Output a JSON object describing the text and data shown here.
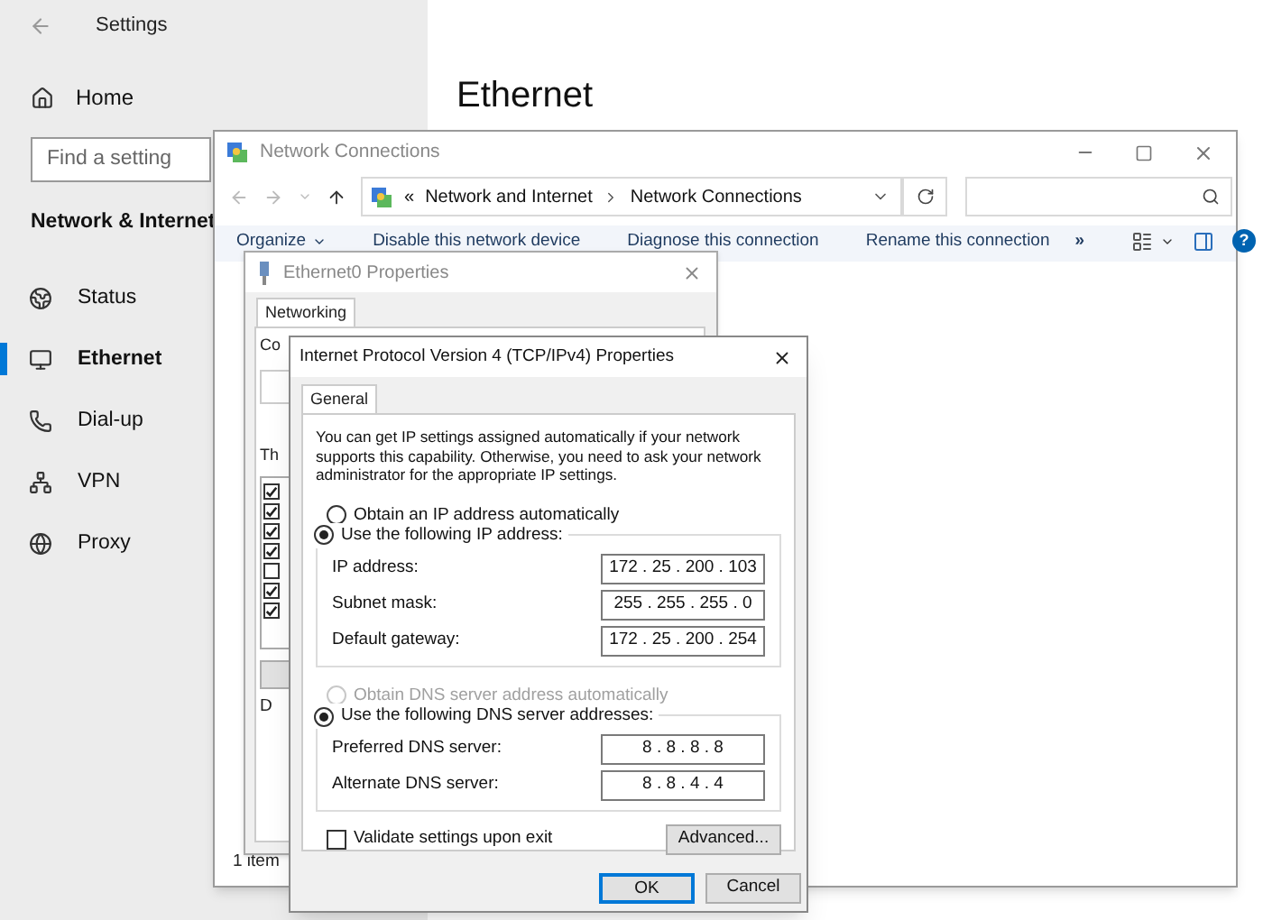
{
  "settings": {
    "title": "Settings",
    "home": "Home",
    "search": {
      "placeholder": "Find a setting"
    },
    "section": "Network & Internet",
    "nav": [
      {
        "label": "Status",
        "kind": "status",
        "selected": false
      },
      {
        "label": "Ethernet",
        "kind": "ethernet",
        "selected": true
      },
      {
        "label": "Dial-up",
        "kind": "dialup",
        "selected": false
      },
      {
        "label": "VPN",
        "kind": "vpn",
        "selected": false
      },
      {
        "label": "Proxy",
        "kind": "proxy",
        "selected": false
      }
    ],
    "page_title": "Ethernet"
  },
  "network_connections": {
    "title": "Network Connections",
    "breadcrumb_prefix": "«",
    "breadcrumb": [
      "Network and Internet",
      "Network Connections"
    ],
    "toolbar": [
      "Organize",
      "Disable this network device",
      "Diagnose this connection",
      "Rename this connection"
    ],
    "toolbar_more": "»",
    "help": "?",
    "status": "1 item"
  },
  "ethernet_properties": {
    "title": "Ethernet0 Properties",
    "tabs": [
      {
        "label": "Networking",
        "selected": true
      }
    ],
    "connect_label": "Co",
    "items_label": "Th",
    "description_label": "D",
    "components": [
      {
        "checked": true
      },
      {
        "checked": true
      },
      {
        "checked": true
      },
      {
        "checked": true
      },
      {
        "checked": false
      },
      {
        "checked": true
      },
      {
        "checked": true
      }
    ]
  },
  "ipv4": {
    "title": "Internet Protocol Version 4 (TCP/IPv4) Properties",
    "tabs": [
      {
        "label": "General",
        "selected": true
      }
    ],
    "intro": "You can get IP settings assigned automatically if your network supports this capability. Otherwise, you need to ask your network administrator for the appropriate IP settings.",
    "ip_mode": [
      {
        "label": "Obtain an IP address automatically",
        "selected": false,
        "disabled": false
      },
      {
        "label": "Use the following IP address:",
        "selected": true,
        "disabled": false
      }
    ],
    "ip_fields": [
      {
        "label": "IP address:",
        "value": "172 . 25 . 200 . 103"
      },
      {
        "label": "Subnet mask:",
        "value": "255 . 255 . 255 . 0"
      },
      {
        "label": "Default gateway:",
        "value": "172 . 25 . 200 . 254"
      }
    ],
    "dns_mode": [
      {
        "label": "Obtain DNS server address automatically",
        "selected": false,
        "disabled": true
      },
      {
        "label": "Use the following DNS server addresses:",
        "selected": true,
        "disabled": false
      }
    ],
    "dns_fields": [
      {
        "label": "Preferred DNS server:",
        "value": "8 . 8 . 8 . 8"
      },
      {
        "label": "Alternate DNS server:",
        "value": "8 . 8 . 4 . 4"
      }
    ],
    "validate": {
      "label": "Validate settings upon exit",
      "checked": false
    },
    "advanced": "Advanced...",
    "buttons": [
      {
        "label": "OK",
        "default": true
      },
      {
        "label": "Cancel",
        "default": false
      }
    ]
  }
}
